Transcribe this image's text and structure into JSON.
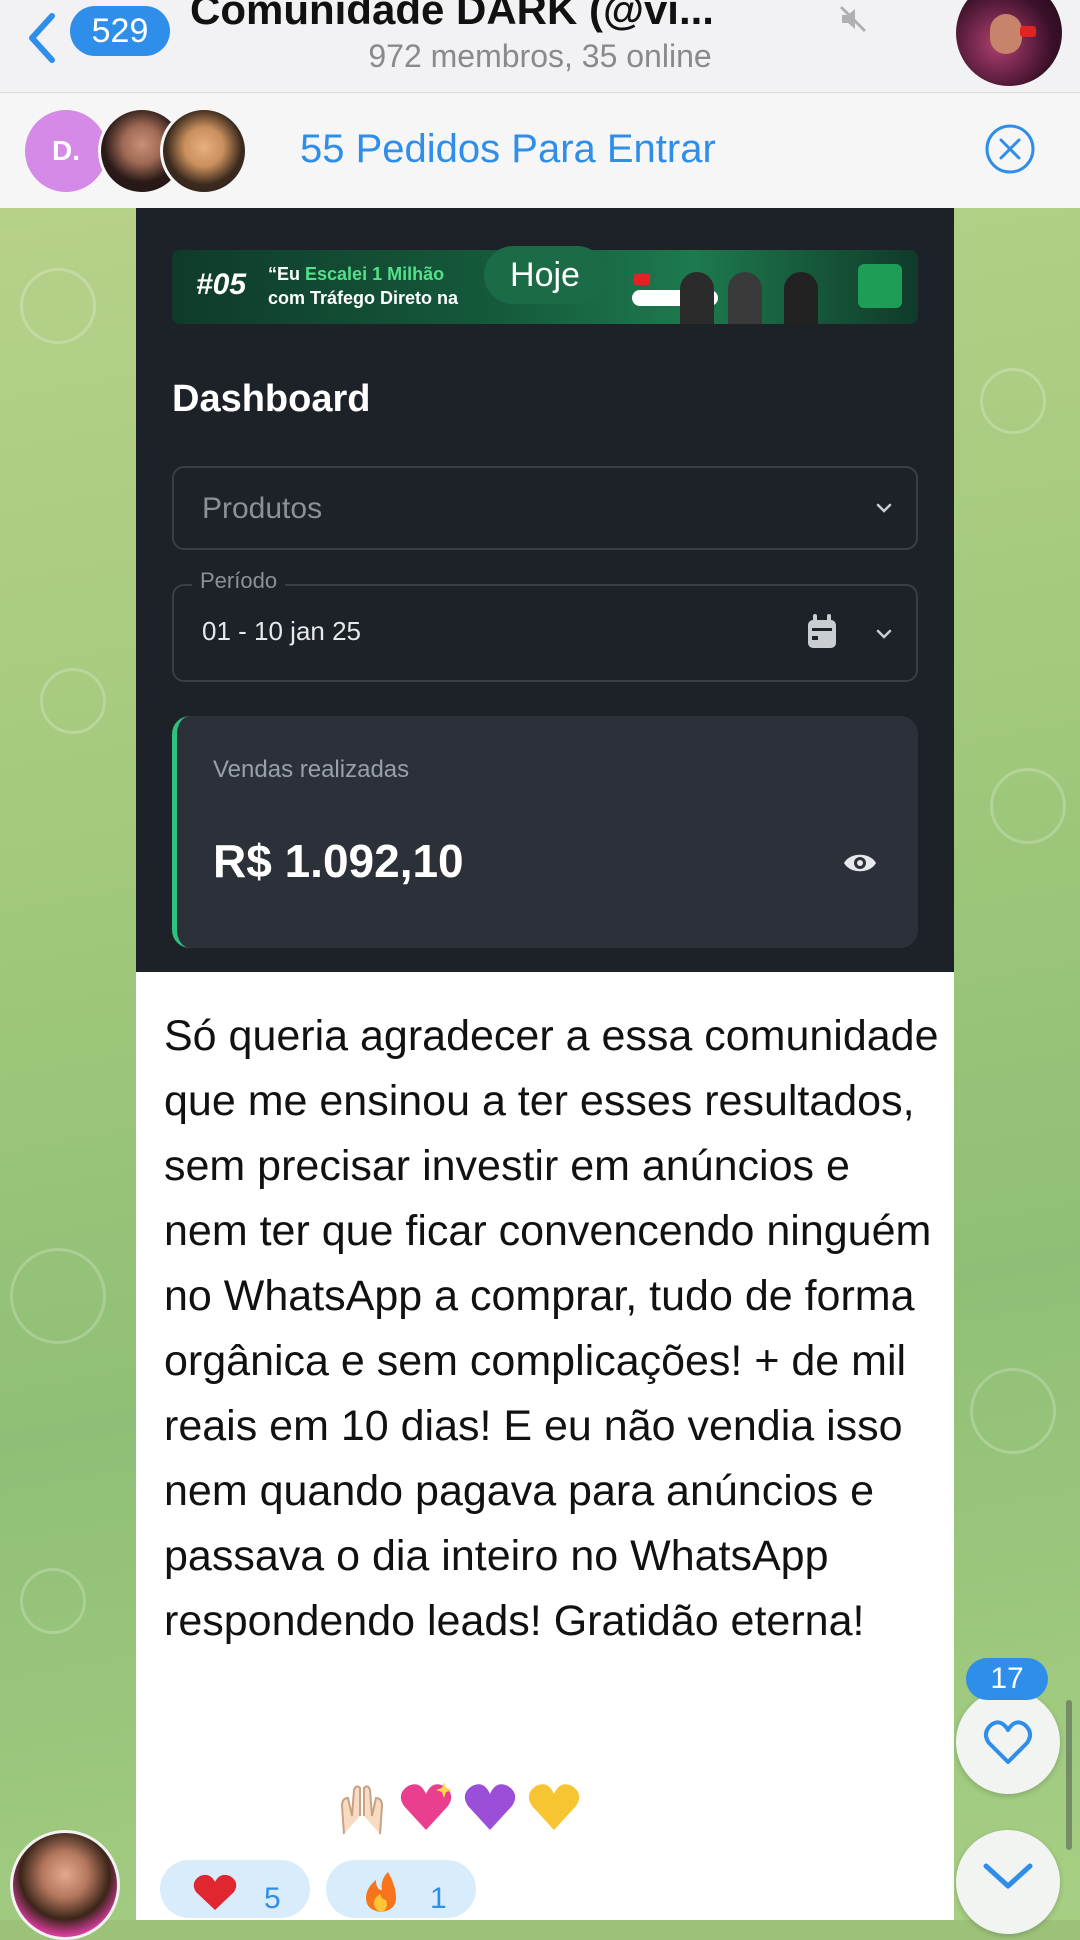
{
  "header": {
    "back_count": "529",
    "title": "Comunidade DARK (@vi...",
    "subtitle": "972 membros, 35 online"
  },
  "join_requests": {
    "avatar_initial": "D.",
    "text": "55 Pedidos Para Entrar"
  },
  "message": {
    "date_badge": "Hoje",
    "banner": {
      "number": "#05",
      "line1_start": "“Eu ",
      "line1_highlight": "Escalei 1 Milhão",
      "line2": "com Tráfego Direto na"
    },
    "dashboard": {
      "title": "Dashboard",
      "products_placeholder": "Produtos",
      "period_label": "Período",
      "period_value": "01 - 10 jan 25",
      "sales_label": "Vendas realizadas",
      "sales_value": "R$ 1.092,10"
    },
    "text": "Só queria agradecer a essa comunidade que me ensinou a ter esses resultados, sem precisar investir em anúncios e nem ter que ficar convencendo ninguém no WhatsApp a comprar, tudo de forma orgânica e sem complicações! + de mil reais em 10 dias! E eu não vendia isso nem quando pagava para anúncios e passava o dia inteiro no WhatsApp respondendo leads! Gratidão eterna!",
    "reactions": [
      {
        "icon": "heart-icon",
        "count": "5"
      },
      {
        "icon": "fire-icon",
        "count": "1"
      }
    ]
  },
  "floating": {
    "like_count": "17"
  },
  "colors": {
    "accent": "#2f8eea",
    "dashboard_bg": "#1d2128",
    "sales_card_bg": "#2b3039",
    "sales_accent": "#2ec27e",
    "join_avatar": "#d48ae6"
  }
}
